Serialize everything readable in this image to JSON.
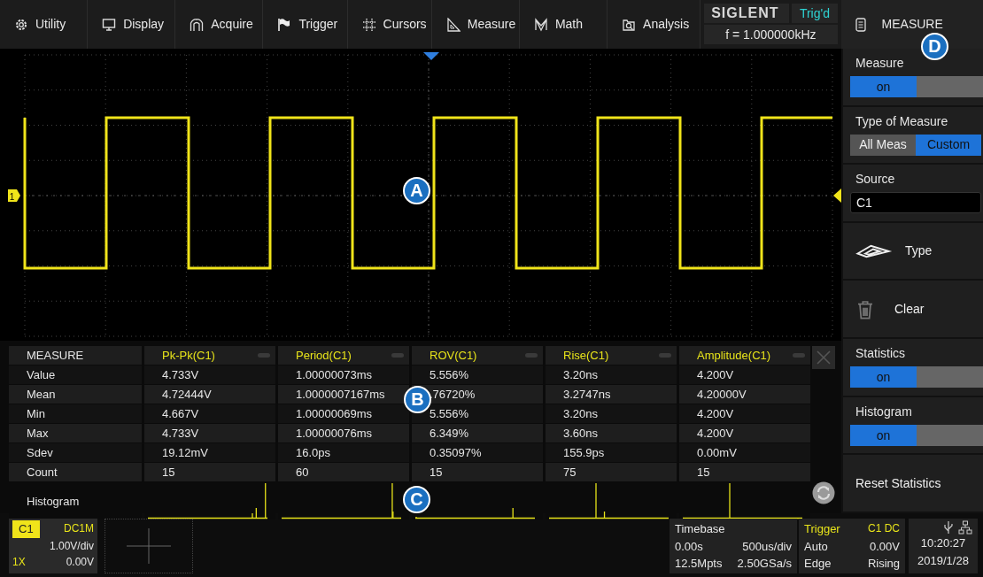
{
  "menu": [
    {
      "label": "Utility"
    },
    {
      "label": "Display"
    },
    {
      "label": "Acquire"
    },
    {
      "label": "Trigger"
    },
    {
      "label": "Cursors"
    },
    {
      "label": "Measure"
    },
    {
      "label": "Math"
    },
    {
      "label": "Analysis"
    }
  ],
  "brand": {
    "logo": "SIGLENT",
    "trigger_status": "Trig'd",
    "frequency": "f = 1.000000kHz"
  },
  "scope": {
    "channel_marker": "1"
  },
  "measure_table": {
    "corner": "MEASURE",
    "columns": [
      "Pk-Pk(C1)",
      "Period(C1)",
      "ROV(C1)",
      "Rise(C1)",
      "Amplitude(C1)"
    ],
    "rows": [
      {
        "label": "Value",
        "cells": [
          "4.733V",
          "1.00000073ms",
          "5.556%",
          "3.20ns",
          "4.200V"
        ]
      },
      {
        "label": "Mean",
        "cells": [
          "4.72444V",
          "1.0000007167ms",
          ".76720%",
          "3.2747ns",
          "4.20000V"
        ]
      },
      {
        "label": "Min",
        "cells": [
          "4.667V",
          "1.00000069ms",
          "5.556%",
          "3.20ns",
          "4.200V"
        ]
      },
      {
        "label": "Max",
        "cells": [
          "4.733V",
          "1.00000076ms",
          "6.349%",
          "3.60ns",
          "4.200V"
        ]
      },
      {
        "label": "Sdev",
        "cells": [
          "19.12mV",
          "16.0ps",
          "0.35097%",
          "155.9ps",
          "0.00mV"
        ]
      },
      {
        "label": "Count",
        "cells": [
          "15",
          "60",
          "15",
          "75",
          "15"
        ]
      }
    ],
    "histogram_label": "Histogram"
  },
  "panel": {
    "title": "MEASURE",
    "items": [
      {
        "kind": "toggle",
        "label": "Measure",
        "value": "on",
        "on": true
      },
      {
        "kind": "segmented",
        "label": "Type of Measure",
        "options": [
          {
            "label": "All Meas",
            "selected": false
          },
          {
            "label": "Custom",
            "selected": true
          }
        ]
      },
      {
        "kind": "field",
        "label": "Source",
        "value": "C1"
      },
      {
        "kind": "action",
        "label": "Type"
      },
      {
        "kind": "action",
        "label": "Clear"
      },
      {
        "kind": "toggle",
        "label": "Statistics",
        "value": "on",
        "on": true
      },
      {
        "kind": "toggle",
        "label": "Histogram",
        "value": "on",
        "on": true
      },
      {
        "kind": "action",
        "label": "Reset Statistics"
      }
    ]
  },
  "status_bar": {
    "channel": {
      "name": "C1",
      "coupling": "DC1M",
      "scale": "1.00V/div",
      "probe": "1X",
      "offset": "0.00V"
    },
    "timebase": {
      "title": "Timebase",
      "delay": "0.00s",
      "scale": "500us/div",
      "memory": "12.5Mpts",
      "sample_rate": "2.50GSa/s"
    },
    "trigger": {
      "title": "Trigger",
      "source": "C1 DC",
      "mode": "Auto",
      "level": "0.00V",
      "type": "Edge",
      "slope": "Rising"
    },
    "time": "10:20:27",
    "date": "2019/1/28"
  },
  "callouts": [
    "A",
    "B",
    "C",
    "D"
  ]
}
